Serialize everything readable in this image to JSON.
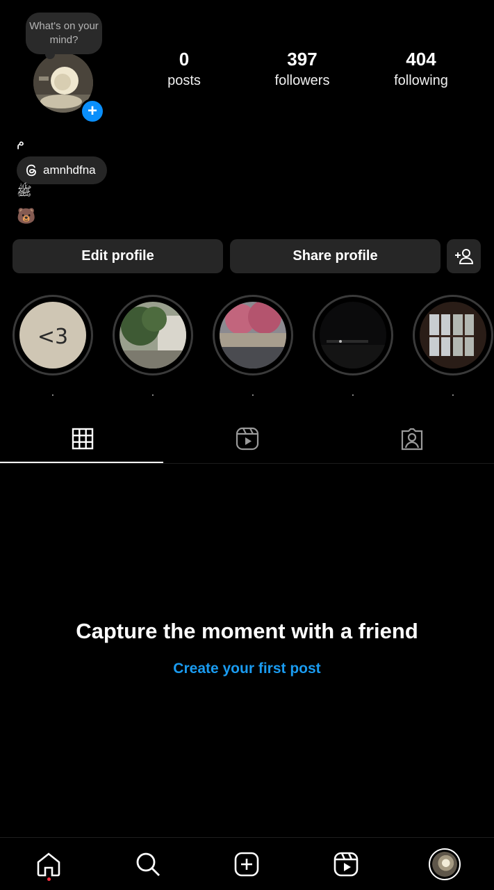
{
  "profile": {
    "note": "What's on your mind?",
    "stats": [
      {
        "value": "0",
        "label": "posts"
      },
      {
        "value": "397",
        "label": "followers"
      },
      {
        "value": "404",
        "label": "following"
      }
    ],
    "name": "م",
    "threads_handle": "amnhdfna",
    "bio_lines": [
      "ﷺ",
      "🐻"
    ]
  },
  "actions": {
    "edit_label": "Edit profile",
    "share_label": "Share profile",
    "add_friend_icon": "person-plus-icon"
  },
  "highlights": [
    {
      "label": ".",
      "cover": "handwritten-3"
    },
    {
      "label": ".",
      "cover": "courtyard-trees"
    },
    {
      "label": ".",
      "cover": "pink-flowers-car"
    },
    {
      "label": ".",
      "cover": "night-street"
    },
    {
      "label": ".",
      "cover": "window-view"
    }
  ],
  "tabs": [
    {
      "icon": "grid-icon",
      "active": true
    },
    {
      "icon": "reels-icon",
      "active": false
    },
    {
      "icon": "tagged-icon",
      "active": false
    }
  ],
  "empty_state": {
    "title": "Capture the moment with a friend",
    "link": "Create your first post"
  },
  "bottom_nav": [
    {
      "icon": "home-icon",
      "notification": true
    },
    {
      "icon": "search-icon"
    },
    {
      "icon": "create-icon"
    },
    {
      "icon": "reels-icon"
    },
    {
      "icon": "profile-avatar"
    }
  ],
  "colors": {
    "accent": "#0a8ffb",
    "link": "#1a9bf0",
    "button_bg": "#262626",
    "notification_dot": "#ff3040"
  }
}
